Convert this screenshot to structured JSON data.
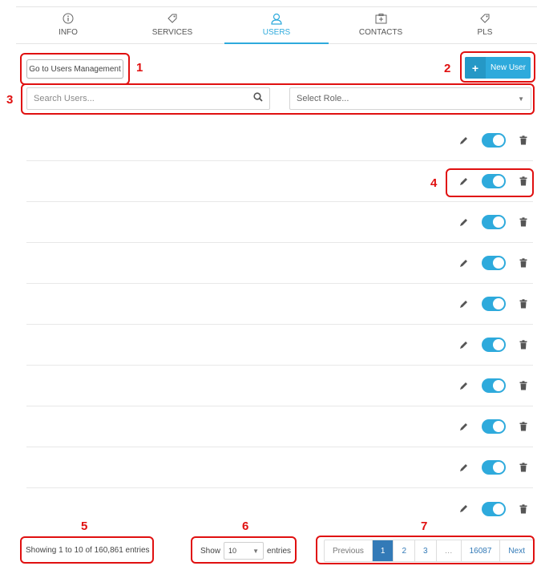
{
  "tabs": [
    {
      "label": "INFO",
      "icon": "info-icon"
    },
    {
      "label": "SERVICES",
      "icon": "tag-icon"
    },
    {
      "label": "USERS",
      "icon": "user-icon",
      "active": true
    },
    {
      "label": "CONTACTS",
      "icon": "contact-card-icon"
    },
    {
      "label": "PLS",
      "icon": "tag-icon"
    }
  ],
  "toolbar": {
    "mgmt_label": "Go to Users Management",
    "new_user_label": "New User",
    "new_user_icon": "+"
  },
  "search": {
    "placeholder": "Search Users..."
  },
  "role": {
    "value": "Select Role..."
  },
  "rows": [
    {},
    {},
    {},
    {},
    {},
    {},
    {},
    {},
    {},
    {}
  ],
  "footer": {
    "info": "Showing 1 to 10 of 160,861 entries",
    "show_label": "Show",
    "entries_value": "10",
    "entries_label": "entries"
  },
  "pager": {
    "previous": "Previous",
    "pages": [
      "1",
      "2",
      "3"
    ],
    "ellipsis": "…",
    "last": "16087",
    "next": "Next"
  },
  "annotations": [
    "1",
    "2",
    "3",
    "4",
    "5",
    "6",
    "7"
  ],
  "colors": {
    "accent": "#2eaadc",
    "pager_active": "#337ab7",
    "annotation": "#e01010"
  }
}
